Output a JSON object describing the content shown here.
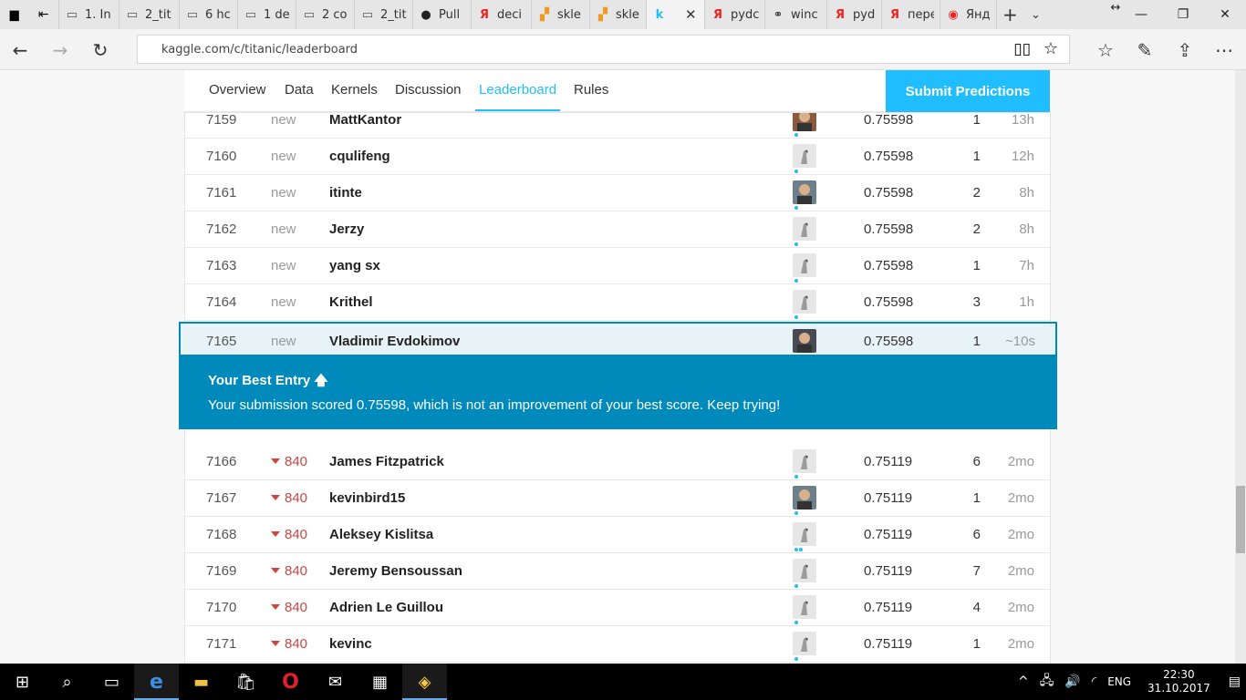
{
  "browser": {
    "tabs": [
      {
        "title": "1. In",
        "icon": "page-icon"
      },
      {
        "title": "2_tit",
        "icon": "page-icon"
      },
      {
        "title": "6 hc",
        "icon": "page-icon"
      },
      {
        "title": "1 de",
        "icon": "page-icon"
      },
      {
        "title": "2 co",
        "icon": "page-icon"
      },
      {
        "title": "2_tit",
        "icon": "page-icon"
      },
      {
        "title": "Pull",
        "icon": "github-icon"
      },
      {
        "title": "deci",
        "icon": "yandex-icon"
      },
      {
        "title": "skle",
        "icon": "sklearn-icon"
      },
      {
        "title": "skle",
        "icon": "sklearn-icon"
      },
      {
        "title": "",
        "icon": "kaggle-icon",
        "active": true
      },
      {
        "title": "pydc",
        "icon": "yandex-icon"
      },
      {
        "title": "winc",
        "icon": "network-icon"
      },
      {
        "title": "pydc",
        "icon": "yandex-icon"
      },
      {
        "title": "пере",
        "icon": "yandex-icon"
      },
      {
        "title": "Янде",
        "icon": "yandex-browser-icon"
      }
    ],
    "url": "kaggle.com/c/titanic/leaderboard"
  },
  "competition_nav": {
    "links": [
      "Overview",
      "Data",
      "Kernels",
      "Discussion",
      "Leaderboard",
      "Rules"
    ],
    "active": "Leaderboard",
    "submit_label": "Submit Predictions"
  },
  "leaderboard": {
    "rows_before": [
      {
        "rank": "7159",
        "change": "new",
        "team": "MattKantor",
        "avatar": "photo",
        "score": "0.75598",
        "entries": "1",
        "last": "13h"
      },
      {
        "rank": "7160",
        "change": "new",
        "team": "cqulifeng",
        "avatar": "default",
        "score": "0.75598",
        "entries": "1",
        "last": "12h"
      },
      {
        "rank": "7161",
        "change": "new",
        "team": "itinte",
        "avatar": "photo",
        "score": "0.75598",
        "entries": "2",
        "last": "8h"
      },
      {
        "rank": "7162",
        "change": "new",
        "team": "Jerzy",
        "avatar": "default",
        "score": "0.75598",
        "entries": "2",
        "last": "8h"
      },
      {
        "rank": "7163",
        "change": "new",
        "team": "yang sx",
        "avatar": "default",
        "score": "0.75598",
        "entries": "1",
        "last": "7h"
      },
      {
        "rank": "7164",
        "change": "new",
        "team": "Krithel",
        "avatar": "default",
        "score": "0.75598",
        "entries": "3",
        "last": "1h"
      }
    ],
    "my_row": {
      "rank": "7165",
      "change": "new",
      "team": "Vladimir Evdokimov",
      "avatar": "photo",
      "score": "0.75598",
      "entries": "1",
      "last": "~10s"
    },
    "best_entry": {
      "title": "Your Best Entry",
      "message": "Your submission scored 0.75598, which is not an improvement of your best score. Keep trying!"
    },
    "rows_after": [
      {
        "rank": "7166",
        "change": "840",
        "team": "James Fitzpatrick",
        "avatar": "default",
        "score": "0.75119",
        "entries": "6",
        "last": "2mo"
      },
      {
        "rank": "7167",
        "change": "840",
        "team": "kevinbird15",
        "avatar": "photo",
        "score": "0.75119",
        "entries": "1",
        "last": "2mo"
      },
      {
        "rank": "7168",
        "change": "840",
        "team": "Aleksey Kislitsa",
        "avatar": "default",
        "score": "0.75119",
        "entries": "6",
        "last": "2mo"
      },
      {
        "rank": "7169",
        "change": "840",
        "team": "Jeremy Bensoussan",
        "avatar": "default",
        "score": "0.75119",
        "entries": "7",
        "last": "2mo"
      },
      {
        "rank": "7170",
        "change": "840",
        "team": "Adrien Le Guillou",
        "avatar": "default",
        "score": "0.75119",
        "entries": "4",
        "last": "2mo"
      },
      {
        "rank": "7171",
        "change": "840",
        "team": "kevinc",
        "avatar": "default",
        "score": "0.75119",
        "entries": "1",
        "last": "2mo"
      }
    ]
  },
  "taskbar": {
    "apps": [
      "start-icon",
      "search-icon",
      "task-view-icon",
      "edge-icon",
      "file-explorer-icon",
      "store-icon",
      "opera-icon",
      "mail-icon",
      "calculator-icon",
      "python-icon"
    ],
    "language": "ENG",
    "time": "22:30",
    "date": "31.10.2017"
  },
  "colors": {
    "accent": "#20beff",
    "best_entry_bg": "#008abc",
    "rank_down": "#cc4444"
  }
}
